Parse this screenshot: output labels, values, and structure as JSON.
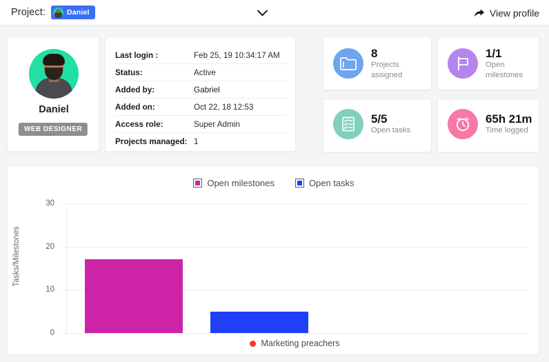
{
  "topbar": {
    "project_label": "Project:",
    "chip_name": "Daniel",
    "chip_avatar_icon": "user-avatar-icon",
    "chevron_icon": "chevron-down-icon",
    "share_icon": "share-arrow-icon",
    "view_profile": "View profile"
  },
  "profile": {
    "avatar_icon": "user-photo-avatar",
    "name": "Daniel",
    "role": "WEB DESIGNER"
  },
  "details": {
    "rows": [
      {
        "key": "Last login :",
        "value": "Feb 25, 19 10:34:17 AM"
      },
      {
        "key": "Status:",
        "value": "Active"
      },
      {
        "key": "Added by:",
        "value": "Gabriel"
      },
      {
        "key": "Added on:",
        "value": "Oct 22, 18 12:53"
      },
      {
        "key": "Access role:",
        "value": "Super Admin"
      },
      {
        "key": "Projects managed:",
        "value": "1"
      }
    ]
  },
  "stats": [
    {
      "value": "8",
      "label_line1": "Projects",
      "label_line2": "assigned",
      "icon": "folder-icon",
      "color": "#6ea4f0"
    },
    {
      "value": "1/1",
      "label_line1": "Open",
      "label_line2": "milestones",
      "icon": "flag-icon",
      "color": "#b685ec"
    },
    {
      "value": "5/5",
      "label_line1": "Open tasks",
      "label_line2": "",
      "icon": "checklist-icon",
      "color": "#7fd0bd"
    },
    {
      "value": "65h 21m",
      "label_line1": "Time logged",
      "label_line2": "",
      "icon": "alarm-clock-icon",
      "color": "#f778a6"
    }
  ],
  "chart_data": {
    "type": "bar",
    "title": "",
    "xlabel": "",
    "ylabel": "Tasks/Milestones",
    "categories": [
      "Open milestones",
      "Open tasks"
    ],
    "values": [
      17,
      5
    ],
    "series": [
      {
        "name": "Open milestones",
        "values": [
          17
        ],
        "color": "#cd23a7"
      },
      {
        "name": "Open tasks",
        "values": [
          5
        ],
        "color": "#1f40f7"
      }
    ],
    "ylim": [
      0,
      30
    ],
    "yticks": [
      "0",
      "10",
      "20",
      "30"
    ],
    "ytick_values": [
      0,
      10,
      20,
      30
    ],
    "grid": true,
    "legend_position": "top-center",
    "legend": [
      {
        "label": "Open milestones",
        "color": "#cd23a7"
      },
      {
        "label": "Open tasks",
        "color": "#1f40f7"
      }
    ],
    "annotation": {
      "label": "Marketing preachers",
      "dot_color": "#f4392d"
    }
  }
}
